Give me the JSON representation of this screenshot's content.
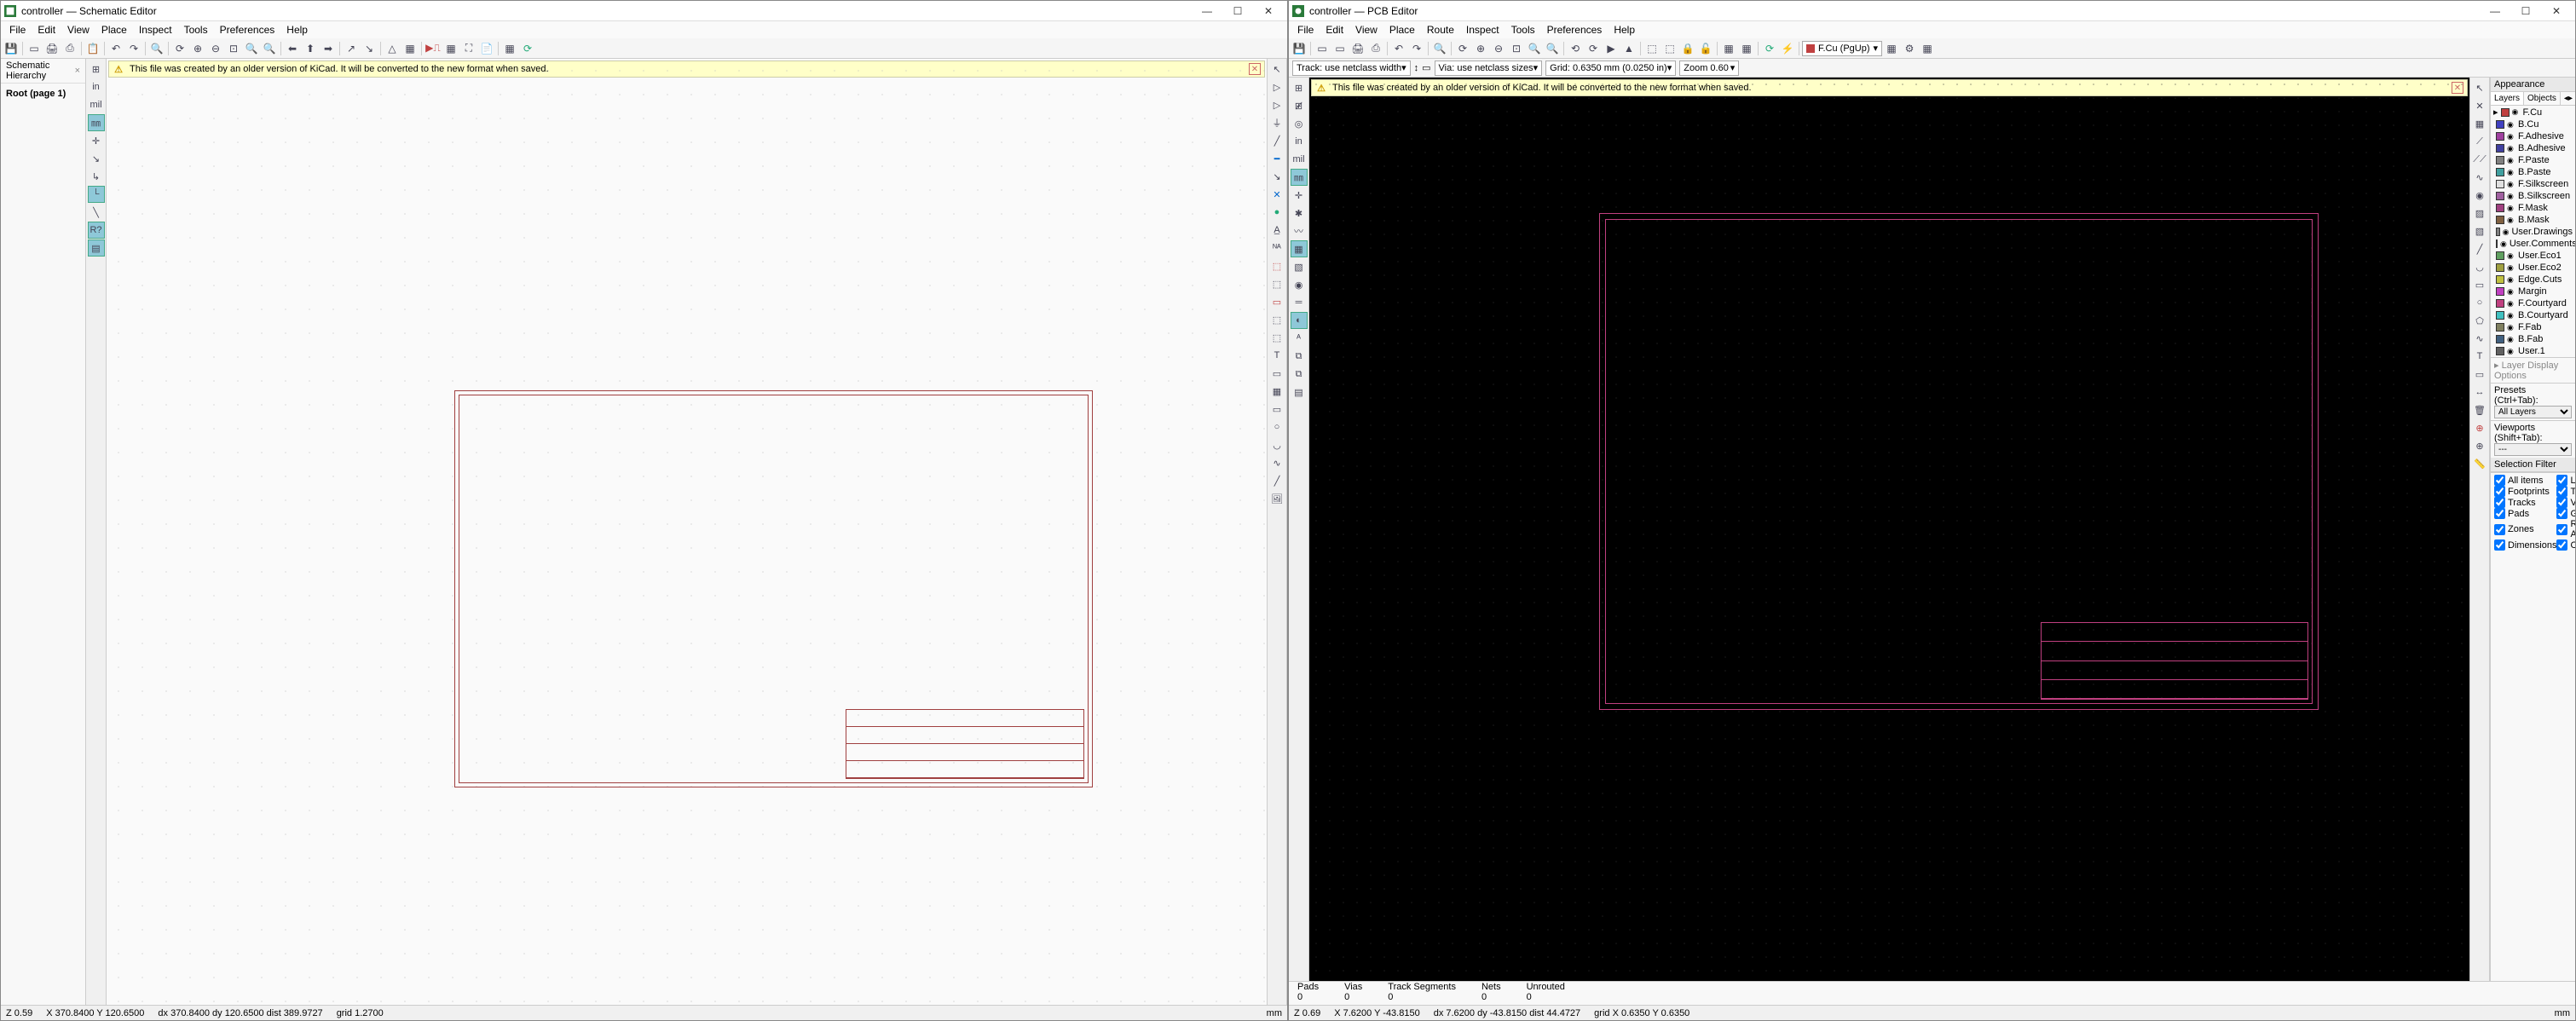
{
  "schematic": {
    "title": "controller — Schematic Editor",
    "menu": [
      "File",
      "Edit",
      "View",
      "Place",
      "Inspect",
      "Tools",
      "Preferences",
      "Help"
    ],
    "warn": "This file was created by an older version of KiCad. It will be converted to the new format when saved.",
    "side_tab": "Schematic Hierarchy",
    "root_node": "Root (page 1)",
    "status": {
      "z": "Z 0.59",
      "xy": "X 370.8400  Y 120.6500",
      "dxy": "dx 370.8400  dy 120.6500  dist 389.9727",
      "grid": "grid 1.2700",
      "unit": "mm"
    }
  },
  "pcb": {
    "title": "controller — PCB Editor",
    "menu": [
      "File",
      "Edit",
      "View",
      "Place",
      "Route",
      "Inspect",
      "Tools",
      "Preferences",
      "Help"
    ],
    "track_dd": "Track: use netclass width",
    "via_dd": "Via: use netclass sizes",
    "grid_dd": "Grid: 0.6350 mm (0.0250 in)",
    "zoom_dd": "Zoom 0.60",
    "warn": "This file was created by an older version of KiCad. It will be converted to the new format when saved.",
    "layer_dd": "F.Cu (PgUp)",
    "appearance": "Appearance",
    "tabs": {
      "layers": "Layers",
      "objects": "Objects"
    },
    "layers": [
      {
        "name": "F.Cu",
        "color": "#c04040"
      },
      {
        "name": "B.Cu",
        "color": "#4040c0"
      },
      {
        "name": "F.Adhesive",
        "color": "#a040a0"
      },
      {
        "name": "B.Adhesive",
        "color": "#4040a0"
      },
      {
        "name": "F.Paste",
        "color": "#808080"
      },
      {
        "name": "B.Paste",
        "color": "#40a0a0"
      },
      {
        "name": "F.Silkscreen",
        "color": "#e0e0e0"
      },
      {
        "name": "B.Silkscreen",
        "color": "#a060a0"
      },
      {
        "name": "F.Mask",
        "color": "#a04080"
      },
      {
        "name": "B.Mask",
        "color": "#806040"
      },
      {
        "name": "User.Drawings",
        "color": "#808080"
      },
      {
        "name": "User.Comments",
        "color": "#4080c0"
      },
      {
        "name": "User.Eco1",
        "color": "#60a060"
      },
      {
        "name": "User.Eco2",
        "color": "#a0a040"
      },
      {
        "name": "Edge.Cuts",
        "color": "#c0c040"
      },
      {
        "name": "Margin",
        "color": "#c040c0"
      },
      {
        "name": "F.Courtyard",
        "color": "#c04080"
      },
      {
        "name": "B.Courtyard",
        "color": "#40c0c0"
      },
      {
        "name": "F.Fab",
        "color": "#808060"
      },
      {
        "name": "B.Fab",
        "color": "#406080"
      },
      {
        "name": "User.1",
        "color": "#606060"
      }
    ],
    "layer_display_label": "Layer Display Options",
    "presets_label": "Presets (Ctrl+Tab):",
    "presets_value": "All Layers",
    "viewports_label": "Viewports (Shift+Tab):",
    "viewports_value": "---",
    "filter_label": "Selection Filter",
    "filters_left": [
      "All items",
      "Footprints",
      "Tracks",
      "Pads",
      "Zones",
      "Dimensions"
    ],
    "filters_right": [
      "Locked",
      "Text",
      "Vias",
      "Graphics",
      "Rule Areas",
      "Other"
    ],
    "stats": {
      "pads": {
        "label": "Pads",
        "val": "0"
      },
      "vias": {
        "label": "Vias",
        "val": "0"
      },
      "segs": {
        "label": "Track Segments",
        "val": "0"
      },
      "nets": {
        "label": "Nets",
        "val": "0"
      },
      "unrouted": {
        "label": "Unrouted",
        "val": "0"
      }
    },
    "status": {
      "z": "Z 0.69",
      "xy": "X 7.6200  Y -43.8150",
      "dxy": "dx 7.6200  dy -43.8150  dist 44.4727",
      "grid": "grid X 0.6350  Y 0.6350",
      "unit": "mm"
    }
  }
}
